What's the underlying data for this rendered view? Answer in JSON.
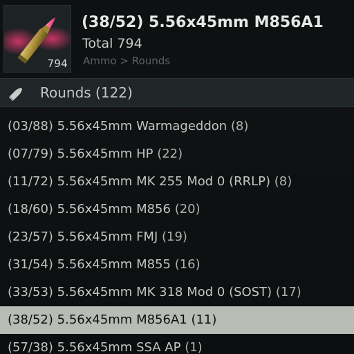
{
  "item": {
    "title": "(38/52) 5.56x45mm M856A1",
    "total": "Total 794",
    "breadcrumb": "Ammo > Rounds",
    "stack_count": "794"
  },
  "category": {
    "icon": "bullet-icon",
    "label": "Rounds (122)"
  },
  "list": [
    {
      "name": "(03/88) 5.56x45mm Warmageddon",
      "count": "(8)",
      "selected": false
    },
    {
      "name": "(07/79) 5.56x45mm HP",
      "count": "(22)",
      "selected": false
    },
    {
      "name": "(11/72) 5.56x45mm MK 255 Mod 0 (RRLP)",
      "count": "(8)",
      "selected": false
    },
    {
      "name": "(18/60) 5.56x45mm M856",
      "count": "(20)",
      "selected": false
    },
    {
      "name": "(23/57) 5.56x45mm FMJ",
      "count": "(19)",
      "selected": false
    },
    {
      "name": "(31/54) 5.56x45mm M855",
      "count": "(16)",
      "selected": false
    },
    {
      "name": "(33/53) 5.56x45mm MK 318 Mod 0 (SOST)",
      "count": "(17)",
      "selected": false
    },
    {
      "name": "(38/52) 5.56x45mm M856A1",
      "count": "(11)",
      "selected": true
    },
    {
      "name": "(57/38) 5.56x45mm SSA AP",
      "count": "(1)",
      "selected": false
    }
  ],
  "colors": {
    "selected_row": "#b9bcb5",
    "tracer_tip": "#ff2d6b",
    "casing": "#b9a24a"
  }
}
